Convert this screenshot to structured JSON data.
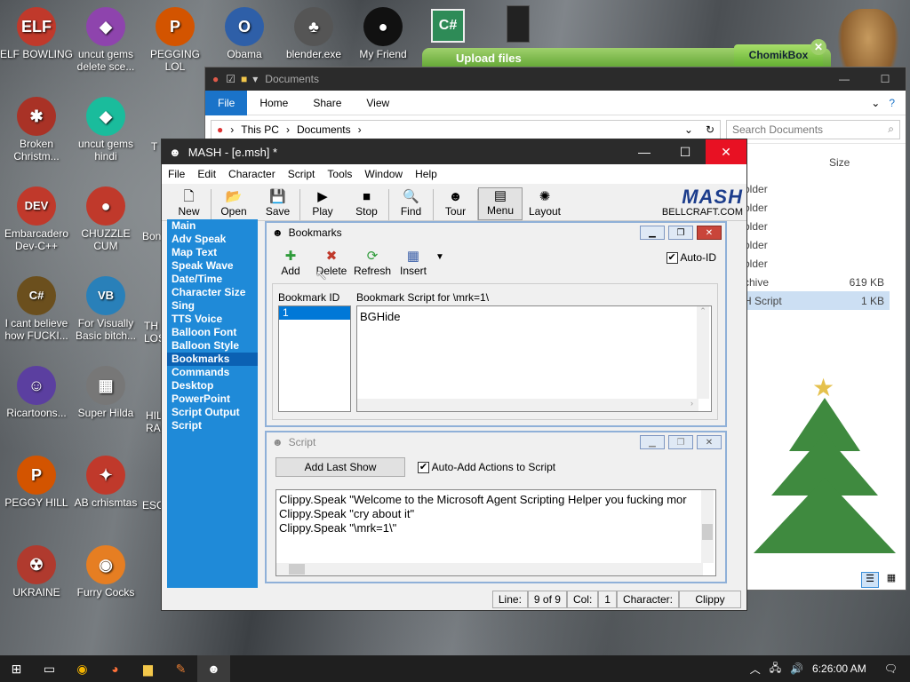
{
  "desktop_icons": [
    {
      "label": "ELF BOWLING",
      "color": "#c0392b",
      "glyph": "ELF"
    },
    {
      "label": "uncut gems delete sce...",
      "color": "#8e44ad",
      "glyph": "◆"
    },
    {
      "label": "PEGGING LOL",
      "color": "#d35400",
      "glyph": "P"
    },
    {
      "label": "Obama",
      "color": "#2e5fa8",
      "glyph": "O"
    },
    {
      "label": "blender.exe",
      "color": "#555555",
      "glyph": "♣"
    },
    {
      "label": "My Friend",
      "color": "#111111",
      "glyph": "●"
    },
    {
      "label": "Broken Christm...",
      "color": "#a93226",
      "glyph": "✱"
    },
    {
      "label": "uncut gems hindi",
      "color": "#1abc9c",
      "glyph": "◆"
    },
    {
      "label": "Embarcadero Dev-C++",
      "color": "#c0392b",
      "glyph": "DEV"
    },
    {
      "label": "CHUZZLE CUM",
      "color": "#c0392b",
      "glyph": "●"
    },
    {
      "label": "I cant believe how FUCKI...",
      "color": "#6b4f1d",
      "glyph": "C#"
    },
    {
      "label": "For Visually Basic bitch...",
      "color": "#2980b9",
      "glyph": "VB"
    },
    {
      "label": "Ricartoons...",
      "color": "#5b3fa0",
      "glyph": "☺"
    },
    {
      "label": "Super Hilda",
      "color": "#777777",
      "glyph": "▦"
    },
    {
      "label": "PEGGY HILL",
      "color": "#d35400",
      "glyph": "P"
    },
    {
      "label": "AB crhismtas",
      "color": "#c0392b",
      "glyph": "✦"
    },
    {
      "label": "UKRAINE",
      "color": "#b03a2e",
      "glyph": "☢"
    },
    {
      "label": "Furry Cocks",
      "color": "#e67e22",
      "glyph": "◉"
    }
  ],
  "desktop_partial_labels": [
    "T",
    "Bon",
    "TH LOS",
    "HIL RA",
    "ESC"
  ],
  "explorer": {
    "title": "Documents",
    "ribbon_tabs": [
      "File",
      "Home",
      "Share",
      "View"
    ],
    "path_parts": [
      "This PC",
      "Documents"
    ],
    "search_placeholder": "Search Documents",
    "size_header": "Size",
    "rows": [
      {
        "name": "older",
        "size": ""
      },
      {
        "name": "older",
        "size": ""
      },
      {
        "name": "older",
        "size": ""
      },
      {
        "name": "older",
        "size": ""
      },
      {
        "name": "older",
        "size": ""
      },
      {
        "name": "chive",
        "size": "619 KB"
      },
      {
        "name": "H Script",
        "size": "1 KB"
      }
    ]
  },
  "upload_banner": {
    "text": "Upload files",
    "app": "ChomikBox"
  },
  "mash": {
    "title": "MASH - [e.msh] *",
    "menu": [
      "File",
      "Edit",
      "Character",
      "Script",
      "Tools",
      "Window",
      "Help"
    ],
    "toolbar": [
      {
        "label": "New",
        "icon": "new-file-icon",
        "glyph": "🗋"
      },
      {
        "label": "Open",
        "icon": "folder-icon",
        "glyph": "📂"
      },
      {
        "label": "Save",
        "icon": "save-icon",
        "glyph": "💾"
      },
      {
        "label": "Play",
        "icon": "play-icon",
        "glyph": "▶"
      },
      {
        "label": "Stop",
        "icon": "stop-icon",
        "glyph": "■"
      },
      {
        "label": "Find",
        "icon": "find-icon",
        "glyph": "🔍"
      },
      {
        "label": "Tour",
        "icon": "tour-icon",
        "glyph": "☻"
      },
      {
        "label": "Menu",
        "icon": "menu-icon",
        "glyph": "▤"
      },
      {
        "label": "Layout",
        "icon": "layout-icon",
        "glyph": "✺"
      }
    ],
    "brand": {
      "logo": "MASH",
      "sub": "BELLCRAFT.COM"
    },
    "sidebar": [
      "Main",
      "Adv Speak",
      "Map Text",
      "Speak Wave",
      "Date/Time",
      "Character Size",
      "Sing",
      "TTS Voice",
      "Balloon Font",
      "Balloon Style",
      "Bookmarks",
      "Commands",
      "Desktop",
      "PowerPoint",
      "Script Output",
      "Script"
    ],
    "sidebar_active": "Bookmarks",
    "status": {
      "line_label": "Line:",
      "line_value": "9 of 9",
      "col_label": "Col:",
      "col_value": "1",
      "char_label": "Character:",
      "char_value": "Clippy"
    }
  },
  "bookmarks": {
    "title": "Bookmarks",
    "toolbar": [
      {
        "label": "Add",
        "glyph": "✚"
      },
      {
        "label": "Delete",
        "glyph": "✖"
      },
      {
        "label": "Refresh",
        "glyph": "⟳"
      },
      {
        "label": "Insert",
        "glyph": "▦"
      }
    ],
    "auto_id_label": "Auto-ID",
    "auto_id_checked": true,
    "id_header": "Bookmark ID",
    "script_header": "Bookmark Script for \\mrk=1\\",
    "ids": [
      "1"
    ],
    "script_text": "BGHide"
  },
  "script": {
    "title": "Script",
    "add_last_show": "Add Last Show",
    "auto_add_label": "Auto-Add Actions to Script",
    "auto_add_checked": true,
    "lines": [
      "Clippy.Speak \"Welcome to the Microsoft Agent Scripting Helper you fucking mor",
      "Clippy.Speak \"cry about it\"",
      "Clippy.Speak \"\\mrk=1\\\""
    ]
  },
  "taskbar": {
    "time": "6:26:00 AM"
  }
}
